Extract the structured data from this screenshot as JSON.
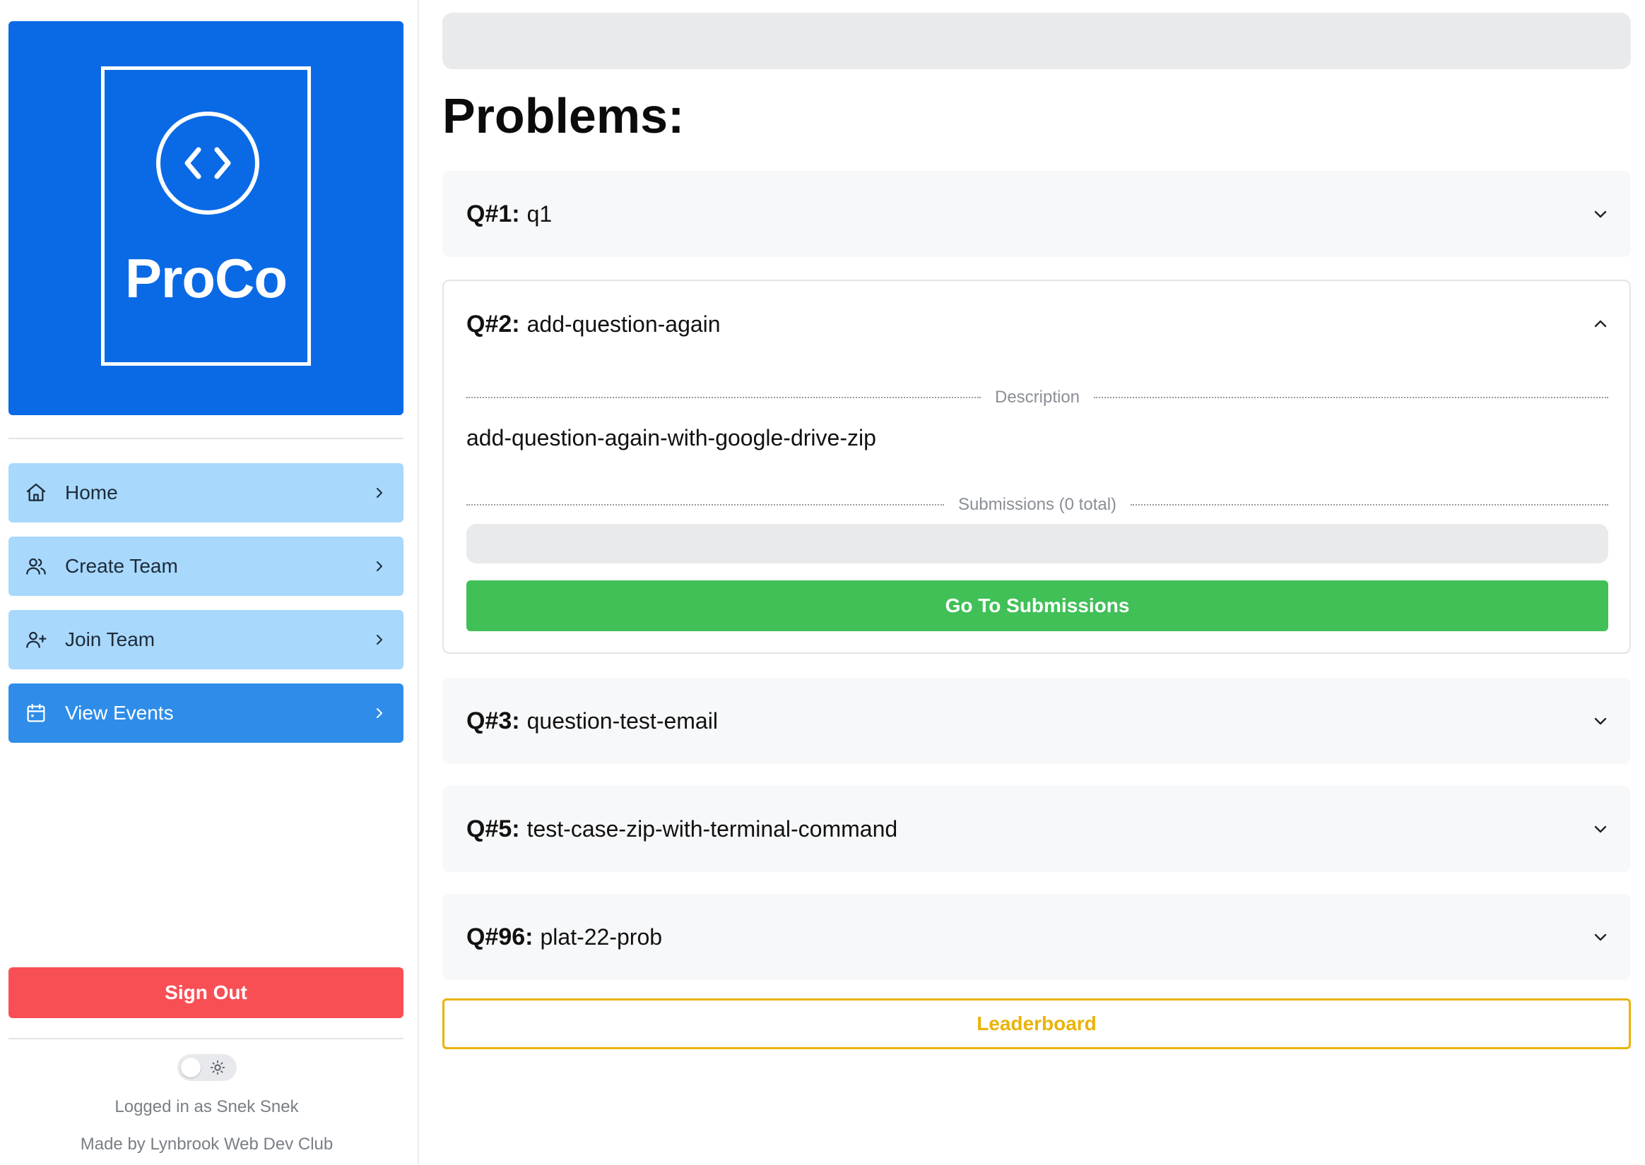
{
  "sidebar": {
    "logo_text": "ProCo",
    "nav": [
      {
        "label": "Home",
        "icon": "home-icon"
      },
      {
        "label": "Create Team",
        "icon": "users-icon"
      },
      {
        "label": "Join Team",
        "icon": "user-plus-icon"
      },
      {
        "label": "View Events",
        "icon": "calendar-icon",
        "active": true
      }
    ],
    "sign_out_label": "Sign Out",
    "theme_toggle": {
      "mode": "light",
      "icon": "sun-icon"
    },
    "logged_in_text": "Logged in as Snek Snek",
    "made_by_text": "Made by Lynbrook Web Dev Club"
  },
  "main": {
    "title": "Problems:",
    "problems": [
      {
        "num": "Q#1:",
        "name": "q1",
        "expanded": false
      },
      {
        "num": "Q#2:",
        "name": "add-question-again",
        "expanded": true,
        "description_label": "Description",
        "description": "add-question-again-with-google-drive-zip",
        "submissions_label": "Submissions (0 total)",
        "go_button_label": "Go To Submissions"
      },
      {
        "num": "Q#3:",
        "name": "question-test-email",
        "expanded": false
      },
      {
        "num": "Q#5:",
        "name": "test-case-zip-with-terminal-command",
        "expanded": false
      },
      {
        "num": "Q#96:",
        "name": "plat-22-prob",
        "expanded": false
      }
    ],
    "leaderboard_label": "Leaderboard"
  },
  "colors": {
    "brand_blue": "#0a6ae6",
    "nav_bg": "#a8d8fc",
    "nav_active_bg": "#2f8de9",
    "sign_out_red": "#f84f55",
    "go_green": "#41c058",
    "leaderboard_yellow": "#eab308"
  }
}
